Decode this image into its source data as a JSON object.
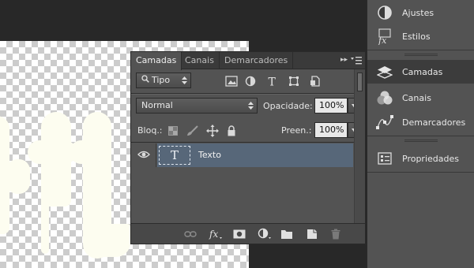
{
  "dock": {
    "items": [
      {
        "label": "Ajustes",
        "icon": "adjustments-icon"
      },
      {
        "label": "Estilos",
        "icon": "styles-icon"
      },
      {
        "label": "Camadas",
        "icon": "layers-icon",
        "active": true
      },
      {
        "label": "Canais",
        "icon": "channels-icon"
      },
      {
        "label": "Demarcadores",
        "icon": "paths-icon"
      },
      {
        "label": "Propriedades",
        "icon": "properties-icon"
      }
    ]
  },
  "panel": {
    "tabs": [
      "Camadas",
      "Canais",
      "Demarcadores"
    ],
    "active_tab": "Camadas",
    "collapse_glyph": "▸▸",
    "filter": {
      "value": "Tipo"
    },
    "blend_mode": {
      "value": "Normal"
    },
    "opacity": {
      "label": "Opacidade:",
      "value": "100%"
    },
    "lock": {
      "label": "Bloq.:"
    },
    "fill": {
      "label": "Preen.:",
      "value": "100%"
    },
    "layers": [
      {
        "name": "Texto",
        "thumb": "T",
        "visible": true,
        "selected": true
      }
    ]
  },
  "colors": {
    "panel_bg": "#535353",
    "selected_layer": "#576779",
    "canvas_glyph": "#fdfdf0"
  }
}
